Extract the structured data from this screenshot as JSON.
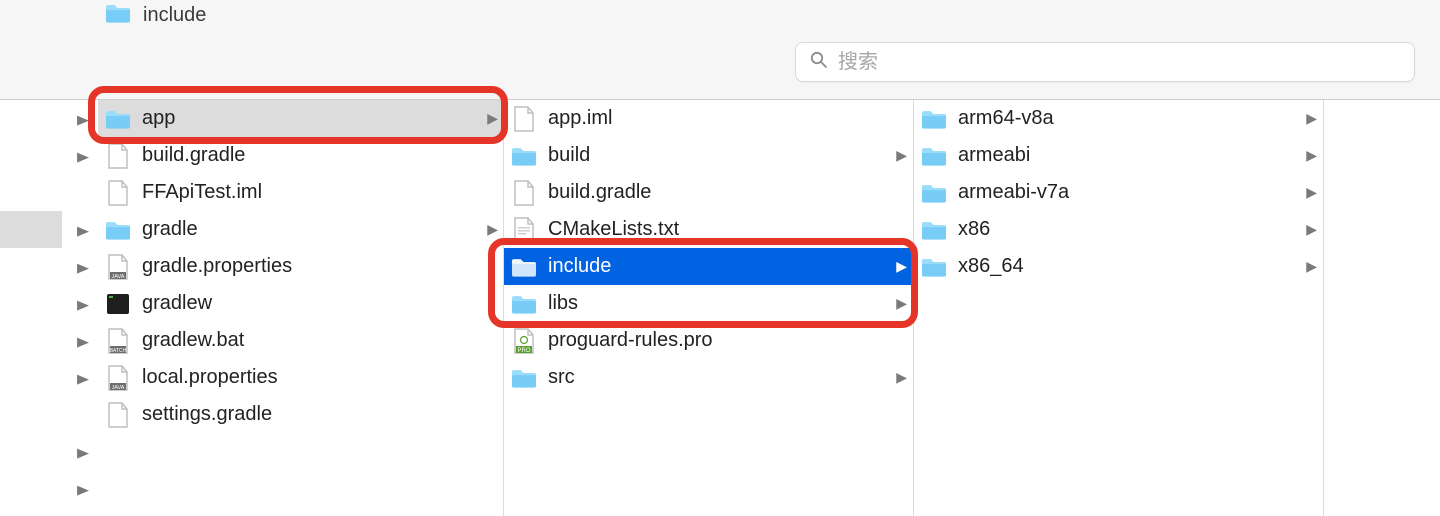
{
  "header": {
    "current_folder": "include",
    "search_placeholder": "搜索",
    "search_value": ""
  },
  "column1": [
    {
      "name": "app",
      "type": "folder",
      "expandable": true,
      "selected": true
    },
    {
      "name": "build.gradle",
      "type": "file",
      "expandable": false
    },
    {
      "name": "FFApiTest.iml",
      "type": "file",
      "expandable": false
    },
    {
      "name": "gradle",
      "type": "folder",
      "expandable": true
    },
    {
      "name": "gradle.properties",
      "type": "java",
      "expandable": false
    },
    {
      "name": "gradlew",
      "type": "terminal",
      "expandable": false
    },
    {
      "name": "gradlew.bat",
      "type": "batch",
      "expandable": false
    },
    {
      "name": "local.properties",
      "type": "java",
      "expandable": false
    },
    {
      "name": "settings.gradle",
      "type": "file",
      "expandable": false
    }
  ],
  "column1_ext_arrows": [
    0,
    1,
    3,
    4,
    5,
    6,
    7,
    9,
    10
  ],
  "column2": [
    {
      "name": "app.iml",
      "type": "file",
      "expandable": false
    },
    {
      "name": "build",
      "type": "folder",
      "expandable": true
    },
    {
      "name": "build.gradle",
      "type": "file",
      "expandable": false
    },
    {
      "name": "CMakeLists.txt",
      "type": "cmake",
      "expandable": false
    },
    {
      "name": "include",
      "type": "folder",
      "expandable": true,
      "selected": true
    },
    {
      "name": "libs",
      "type": "folder",
      "expandable": true
    },
    {
      "name": "proguard-rules.pro",
      "type": "pro",
      "expandable": false
    },
    {
      "name": "src",
      "type": "folder",
      "expandable": true
    }
  ],
  "column3": [
    {
      "name": "arm64-v8a",
      "type": "folder",
      "expandable": true
    },
    {
      "name": "armeabi",
      "type": "folder",
      "expandable": true
    },
    {
      "name": "armeabi-v7a",
      "type": "folder",
      "expandable": true
    },
    {
      "name": "x86",
      "type": "folder",
      "expandable": true
    },
    {
      "name": "x86_64",
      "type": "folder",
      "expandable": true
    }
  ],
  "highlights": {
    "box1": {
      "column": 1,
      "rows": [
        0
      ]
    },
    "box2": {
      "column": 2,
      "rows": [
        4,
        5
      ]
    }
  }
}
